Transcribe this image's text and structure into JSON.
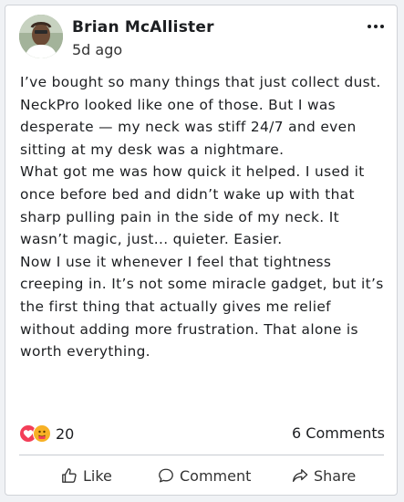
{
  "post": {
    "author": "Brian McAllister",
    "time": "5d ago",
    "paragraphs": [
      "I’ve bought so many things that just collect dust. NeckPro looked like one of those. But I was desperate — my neck was stiff 24/7 and even sitting at my desk was a nightmare.",
      "What got me was how quick it helped. I used it once before bed and didn’t wake up with that sharp pulling pain in the side of my neck. It wasn’t magic, just... quieter. Easier.",
      "Now I use it whenever I feel that tightness creeping in. It’s not some miracle gadget, but it’s the first thing that actually gives me relief without adding more frustration. That alone is worth everything."
    ]
  },
  "stats": {
    "reactions_icons": [
      "love-reaction-icon",
      "care-reaction-icon"
    ],
    "reactions_count": "20",
    "comments": "6 Comments"
  },
  "actions": {
    "like": "Like",
    "comment": "Comment",
    "share": "Share"
  },
  "colors": {
    "love": "#f33e58",
    "care": "#f7b125",
    "divider": "#c8ccd1"
  }
}
